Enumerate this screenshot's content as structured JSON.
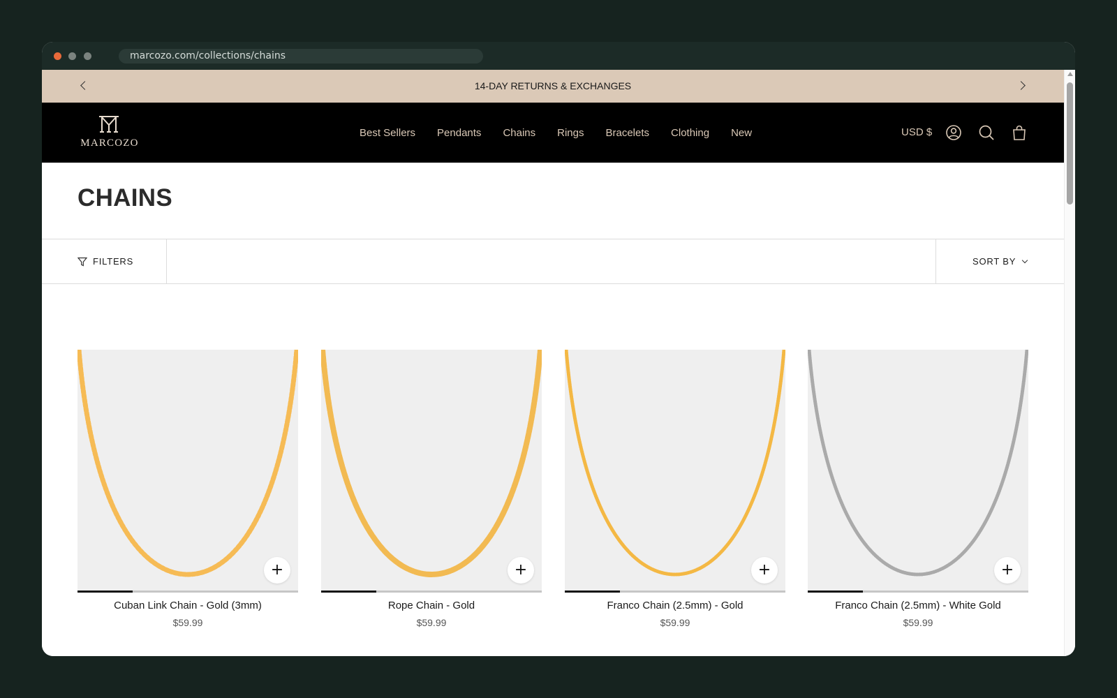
{
  "browser": {
    "url": "marcozo.com/collections/chains"
  },
  "announcement": {
    "text": "14-DAY RETURNS & EXCHANGES"
  },
  "header": {
    "logo_text": "MARCOZO",
    "nav": [
      "Best Sellers",
      "Pendants",
      "Chains",
      "Rings",
      "Bracelets",
      "Clothing",
      "New"
    ],
    "currency": "USD $",
    "icons": [
      "account-icon",
      "search-icon",
      "cart-bag-icon"
    ]
  },
  "page": {
    "title": "CHAINS"
  },
  "toolbar": {
    "filters_label": "FILTERS",
    "sort_label": "SORT BY"
  },
  "products": [
    {
      "name": "Cuban Link Chain - Gold (3mm)",
      "price": "$59.99",
      "color": "#f6bb55",
      "style": "cuban",
      "gallery_progress": 0.25
    },
    {
      "name": "Rope Chain - Gold",
      "price": "$59.99",
      "color": "#f2ba52",
      "style": "rope",
      "gallery_progress": 0.25
    },
    {
      "name": "Franco Chain (2.5mm) - Gold",
      "price": "$59.99",
      "color": "#f4b844",
      "style": "franco",
      "gallery_progress": 0.25
    },
    {
      "name": "Franco Chain (2.5mm) - White Gold",
      "price": "$59.99",
      "color": "#aaaaaa",
      "style": "franco",
      "gallery_progress": 0.25
    }
  ],
  "products_row2": [
    {
      "color": "#b5b5b5",
      "style": "cuban"
    },
    {
      "color": "#b5b5b5",
      "style": "rope"
    },
    {
      "color": "#1a1a1a",
      "style": "franco"
    },
    {
      "color": "#1a1a1a",
      "style": "rope"
    }
  ],
  "colors": {
    "announcement_bg": "#dbc9b7",
    "header_bg": "#000000",
    "nav_text": "#d9c8b6"
  }
}
